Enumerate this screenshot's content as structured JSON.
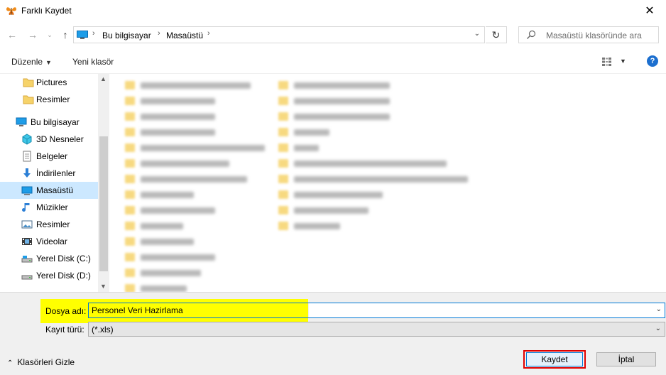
{
  "window": {
    "title": "Farklı Kaydet"
  },
  "address": {
    "crumbs": [
      "Bu bilgisayar",
      "Masaüstü"
    ],
    "search_placeholder": "Masaüstü klasöründe ara"
  },
  "toolbar": {
    "organize": "Düzenle",
    "new_folder": "Yeni klasör"
  },
  "navpane": {
    "items": [
      {
        "label": "Pictures",
        "icon": "folder-icon"
      },
      {
        "label": "Resimler",
        "icon": "folder-icon"
      },
      {
        "label": "Bu bilgisayar",
        "icon": "computer-icon"
      },
      {
        "label": "3D Nesneler",
        "icon": "3d-objects-icon"
      },
      {
        "label": "Belgeler",
        "icon": "documents-icon"
      },
      {
        "label": "İndirilenler",
        "icon": "download-icon"
      },
      {
        "label": "Masaüstü",
        "icon": "desktop-icon",
        "selected": true
      },
      {
        "label": "Müzikler",
        "icon": "music-icon"
      },
      {
        "label": "Resimler",
        "icon": "pictures-icon"
      },
      {
        "label": "Videolar",
        "icon": "videos-icon"
      },
      {
        "label": "Yerel Disk (C:)",
        "icon": "drive-icon"
      },
      {
        "label": "Yerel Disk (D:)",
        "icon": "drive-icon"
      }
    ]
  },
  "form": {
    "filename_label": "Dosya adı:",
    "filename_value": "Personel Veri Hazirlama",
    "filetype_label": "Kayıt türü:",
    "filetype_value": "(*.xls)"
  },
  "footer": {
    "hide_folders": "Klasörleri Gizle",
    "save": "Kaydet",
    "cancel": "İptal"
  },
  "colors": {
    "accent": "#0078d7",
    "selection": "#cce8ff",
    "highlight": "#ffff00",
    "save_outline": "#e00000"
  }
}
